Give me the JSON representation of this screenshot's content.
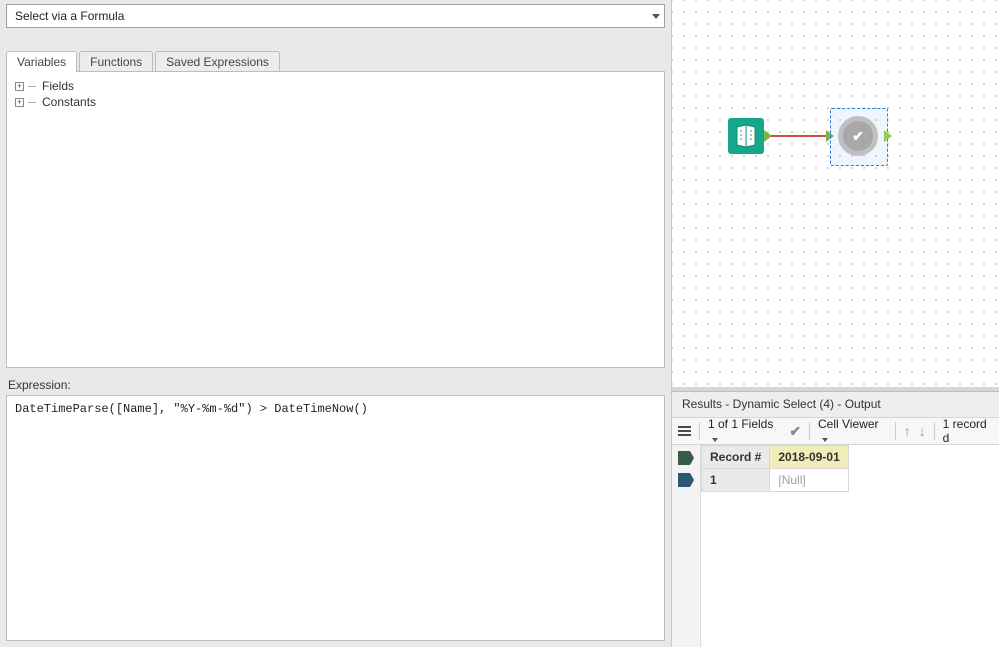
{
  "dropdown": {
    "value": "Select via a Formula"
  },
  "tabs": [
    {
      "label": "Variables",
      "active": true
    },
    {
      "label": "Functions",
      "active": false
    },
    {
      "label": "Saved Expressions",
      "active": false
    }
  ],
  "tree": {
    "items": [
      {
        "label": "Fields"
      },
      {
        "label": "Constants"
      }
    ]
  },
  "expression": {
    "label": "Expression:",
    "value": "DateTimeParse([Name], \"%Y-%m-%d\") > DateTimeNow()"
  },
  "canvas": {
    "node1": "data-input-tool",
    "node2": "dynamic-select-tool"
  },
  "results": {
    "title": "Results - Dynamic Select (4) - Output",
    "fields_summary": "1 of 1 Fields",
    "cell_viewer": "Cell Viewer",
    "record_summary": "1 record d",
    "headers": {
      "rownum": "Record #",
      "col1": "2018-09-01"
    },
    "rows": [
      {
        "num": "1",
        "col1": "[Null]"
      }
    ]
  }
}
